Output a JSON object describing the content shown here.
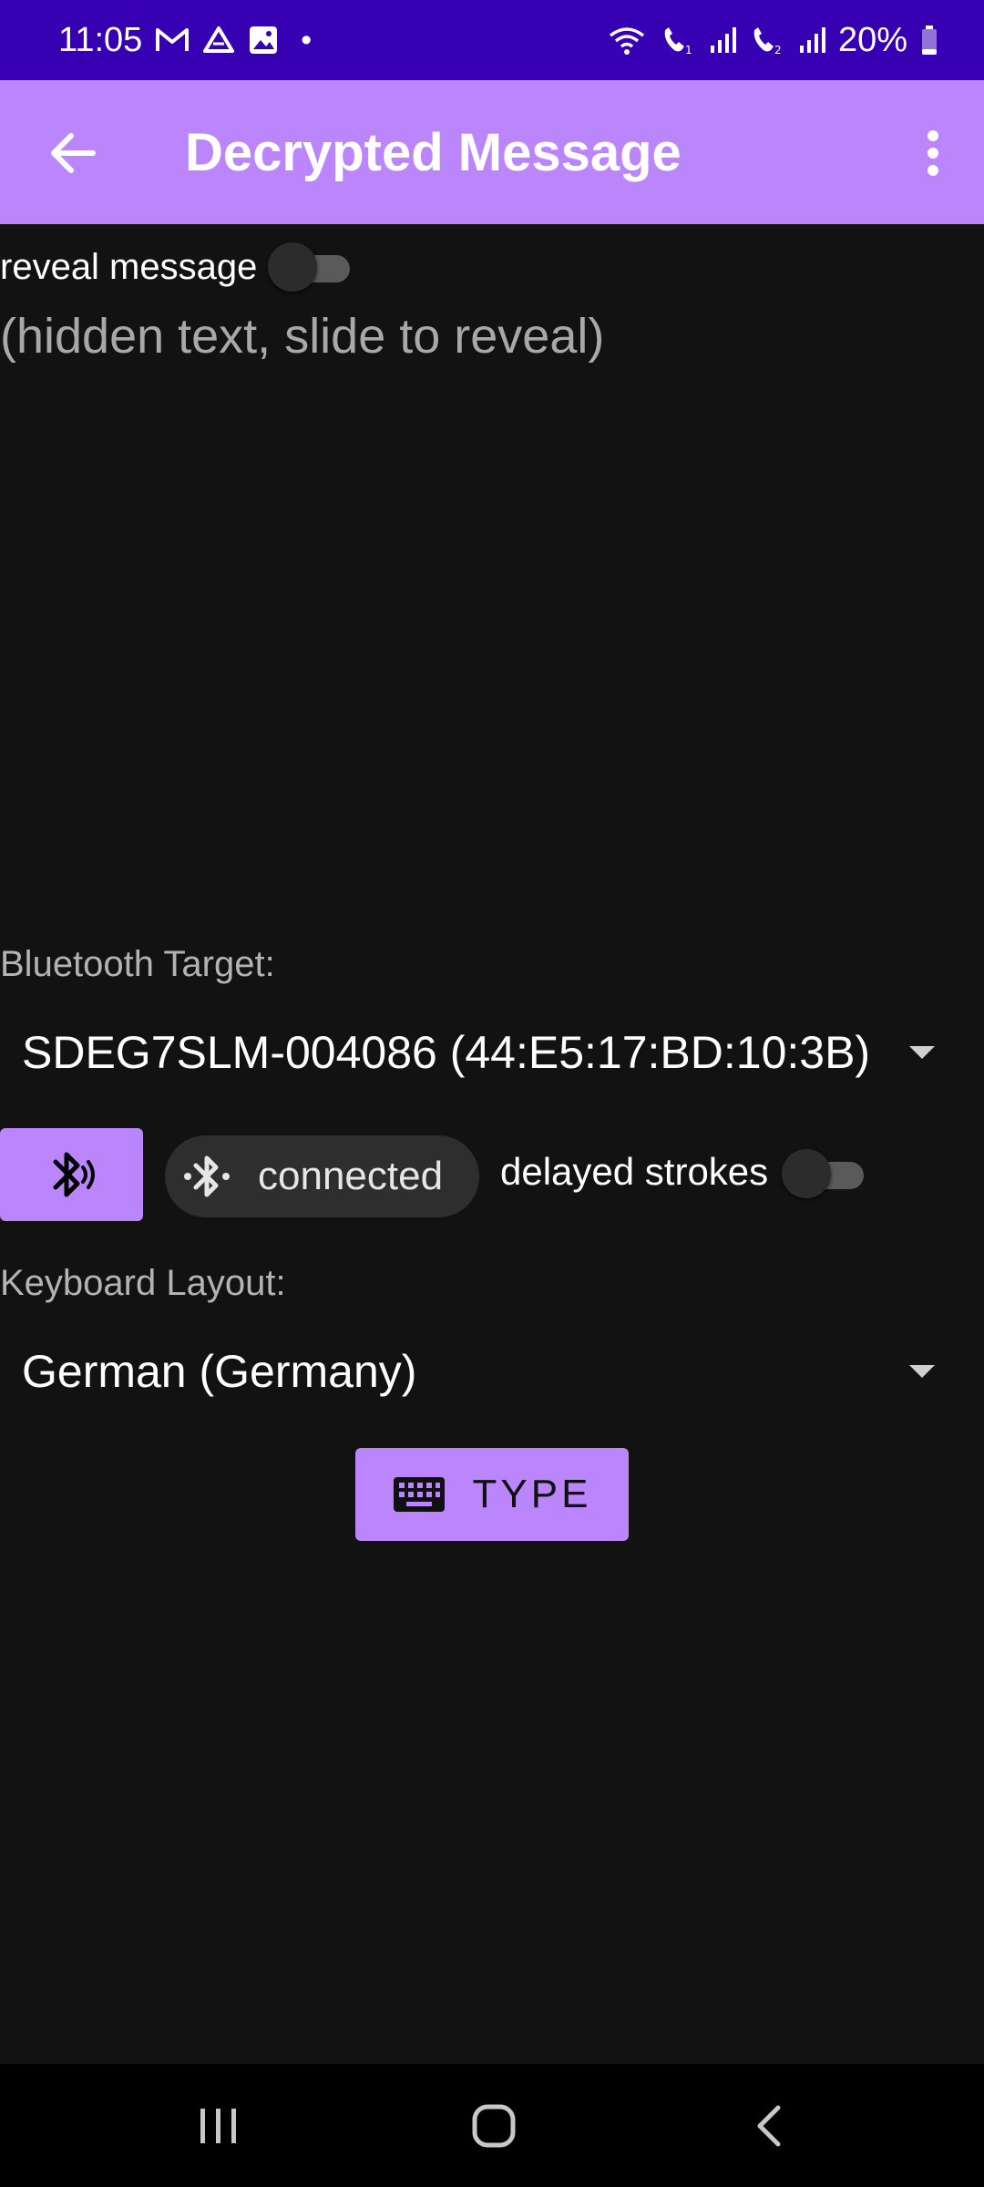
{
  "status_bar": {
    "time": "11:05",
    "battery": "20%",
    "dot": "•",
    "left_icons": [
      "gmail-icon",
      "drive-icon",
      "gallery-icon"
    ],
    "right_icons": [
      "wifi-icon",
      "call-sim1-icon",
      "signal-icon",
      "call-sim2-icon",
      "signal-icon",
      "battery-icon"
    ]
  },
  "app_bar": {
    "title": "Decrypted Message",
    "back_icon": "arrow-back-icon",
    "menu_icon": "more-vert-icon",
    "background": "#bb86fc"
  },
  "reveal": {
    "label": "reveal message",
    "enabled": false,
    "hidden_text": "(hidden text, slide to reveal)"
  },
  "bluetooth": {
    "label": "Bluetooth Target:",
    "selected_device": "SDEG7SLM-004086 (44:E5:17:BD:10:3B)",
    "button_icon": "bluetooth-searching-icon",
    "status_chip": {
      "icon": "bluetooth-icon",
      "label": "connected"
    },
    "delayed_strokes": {
      "label": "delayed strokes",
      "enabled": false
    }
  },
  "keyboard": {
    "label": "Keyboard Layout:",
    "selected_layout": "German (Germany)"
  },
  "type_button": {
    "label": "TYPE",
    "icon": "keyboard-icon"
  },
  "nav_bar": {
    "recents_icon": "recents-icon",
    "home_icon": "home-icon",
    "back_icon": "nav-back-icon"
  },
  "colors": {
    "status_bar": "#3700b3",
    "accent": "#bb86fc",
    "background": "#121212"
  }
}
